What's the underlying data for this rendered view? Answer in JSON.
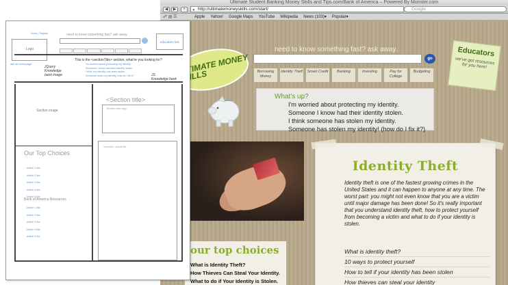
{
  "browser": {
    "title": "Ultimate Student Banking Money Skills and Tips.com/Bank of America – Powered By Monster.com",
    "url": "http://ultimatemoneyskills.com/start/",
    "search_placeholder": "Google",
    "bookmarks": [
      "Apple",
      "Yahoo!",
      "Google Maps",
      "YouTube",
      "Wikipedia",
      "News (103)▾",
      "Popular▾"
    ]
  },
  "site": {
    "logo_text": "ULTIMATE MONEY SKILLS",
    "search_label": "need to know something fast? ask away.",
    "go_label": "go",
    "nav_tabs": [
      "Borrowing Money",
      "Identity Theft",
      "Smart Credit",
      "Banking",
      "Investing",
      "Pay for College",
      "Budgeting"
    ],
    "educators_title": "Educators",
    "educators_text": "we've got resources for you here!",
    "whatsup_title": "What's up?",
    "whatsup_items": [
      "I'm worried about protecting my identity.",
      "Someone I know had their identity stolen.",
      "I think someone has stolen my identity.",
      "Someone has stolen my identity! (how do I fix it?)"
    ],
    "article_title": "Identity Theft",
    "article_body": "Identity theft is one of the fastest growing crimes in the United States and it can happen to anyone at any time. The worst part: you might not even know that you are a victim until major damage has been done! So it's really important that you understand identity theft, how to protect yourself from becoming a victim and what to do if your identity is stolen.",
    "article_questions": [
      "What is identity theft?",
      "10 ways to protect yourself",
      "How to tell if your identity has been stolen",
      "How thieves can steal your identity"
    ],
    "choices_title": "our top choices",
    "choices_items": [
      "What is Identity Theft?",
      "How Thieves Can Steal Your Identity.",
      "What to do if  Your Identity is Stolen."
    ]
  },
  "wireframe": {
    "top_link": "Home | Register",
    "logo": "Logo",
    "ask_label": "need to know something fast? ask away.",
    "educators": "educators link",
    "bar_left": "ask all homepage",
    "jquery": "JQuery\nKnowledge\nbank image",
    "question_title": "This is the <sectionTitle> section, what're you looking for?",
    "questions": [
      "I'm worried about protecting my identity",
      "Someone I know had their identity stolen",
      "I think my identity has been stolen",
      "Someone stole my identity, how do I fix it?"
    ],
    "js": "JS\nKnowledge bank",
    "section_image": "Section image",
    "section_title": "<Section title>",
    "section_intro": "Section intro copy",
    "article_list": "<section> article list",
    "top_choices": "Our Top Choices",
    "articles": [
      "Article 1 link",
      "Article 2 link",
      "Article 3 link",
      "Article 4 link",
      "Article 5 link"
    ],
    "boa_resources": "Bank of America Resources",
    "boa_articles": [
      "Article 1 link",
      "Article 2 link",
      "Article 3 link",
      "Article 4 link",
      "Article 5 link"
    ]
  }
}
